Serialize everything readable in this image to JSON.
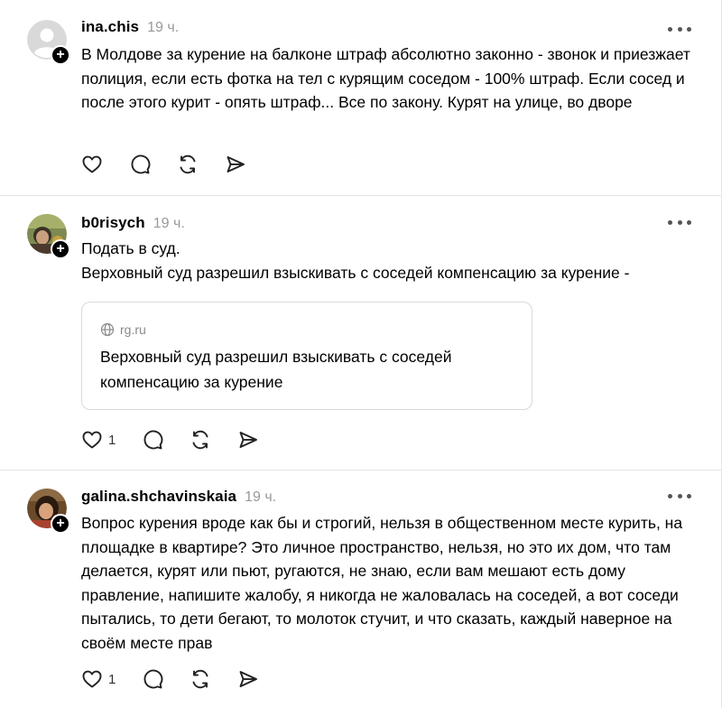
{
  "posts": [
    {
      "username": "ina.chis",
      "time": "19 ч.",
      "text": "В Молдове за курение на балконе штраф абсолютно законно - звонок и приезжает полиция, если есть фотка на тел с курящим соседом - 100% штраф. Если сосед и после этого курит - опять штраф... Все по закону. Курят на улице, во дворе",
      "likes": ""
    },
    {
      "username": "b0risych",
      "time": "19 ч.",
      "text_line1": "Подать в суд.",
      "text_line2": "Верховный суд разрешил взыскивать с соседей компенсацию за курение -",
      "link": {
        "domain": "rg.ru",
        "title": "Верховный суд разрешил взыскивать с соседей компенсацию за курение"
      },
      "likes": "1"
    },
    {
      "username": "galina.shchavinskaia",
      "time": "19 ч.",
      "text": "Вопрос курения вроде как бы и строгий, нельзя в общественном месте курить, на площадке в квартире? Это личное пространство, нельзя, но это их дом, что там делается, курят или пьют, ругаются, не знаю, если вам мешают есть дому правление, напишите жалобу, я никогда не жаловалась на соседей, а вот соседи пытались, то дети бегают, то молоток стучит, и что сказать, каждый наверное на своём месте прав",
      "likes": "1"
    }
  ],
  "icons": {
    "like": "heart-icon",
    "reply": "comment-icon",
    "repost": "repost-icon",
    "share": "send-icon",
    "more": "more-dots-icon",
    "follow": "plus-icon",
    "globe": "globe-icon"
  },
  "colors": {
    "text": "#000000",
    "muted": "#999999",
    "divider": "#e3e3e3",
    "badge": "#000000"
  }
}
